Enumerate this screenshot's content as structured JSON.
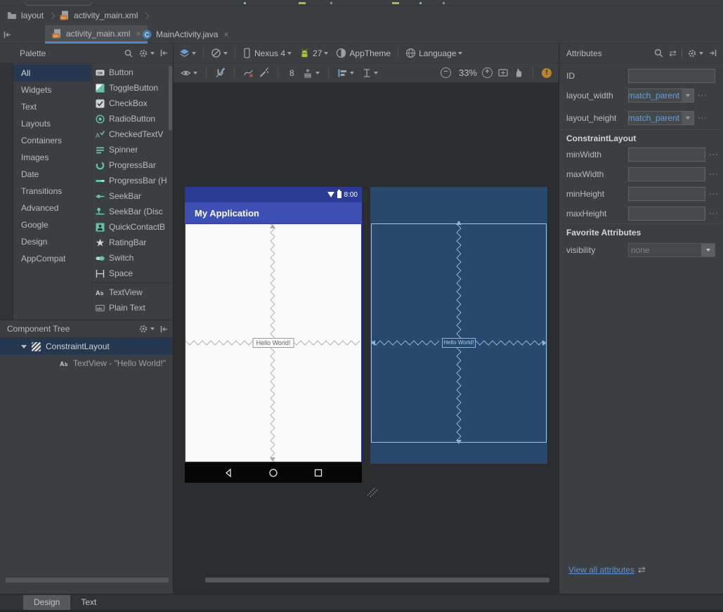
{
  "breadcrumb": {
    "items": [
      "layout",
      "activity_main.xml"
    ]
  },
  "editor_tabs": {
    "tabs": [
      {
        "label": "activity_main.xml",
        "close": "×"
      },
      {
        "label": "MainActivity.java",
        "close": "×"
      }
    ]
  },
  "palette": {
    "title": "Palette",
    "categories": [
      "All",
      "Widgets",
      "Text",
      "Layouts",
      "Containers",
      "Images",
      "Date",
      "Transitions",
      "Advanced",
      "Google",
      "Design",
      "AppCompat"
    ],
    "selected_category": "All",
    "items": [
      "Button",
      "ToggleButton",
      "CheckBox",
      "RadioButton",
      "CheckedTextV",
      "Spinner",
      "ProgressBar",
      "ProgressBar (H",
      "SeekBar",
      "SeekBar (Disc",
      "QuickContactB",
      "RatingBar",
      "Switch",
      "Space",
      "TextView",
      "Plain Text"
    ]
  },
  "component_tree": {
    "title": "Component Tree",
    "nodes": [
      {
        "label": "ConstraintLayout"
      },
      {
        "label": "TextView - \"Hello World!\""
      }
    ]
  },
  "design_toolbar": {
    "device": "Nexus 4",
    "api_level": "27",
    "theme": "AppTheme",
    "language": "Language",
    "default_margin": "8",
    "zoom_level": "33%",
    "zoom_out": "−",
    "zoom_in": "+",
    "error_badge": "!"
  },
  "preview": {
    "time": "8:00",
    "app_title": "My Application",
    "hello_text": "Hello World!"
  },
  "attributes": {
    "title": "Attributes",
    "id_label": "ID",
    "id_value": "",
    "layout_width_label": "layout_width",
    "layout_width_value": "match_parent",
    "layout_height_label": "layout_height",
    "layout_height_value": "match_parent",
    "constraint_section": "ConstraintLayout",
    "min_width_label": "minWidth",
    "max_width_label": "maxWidth",
    "min_height_label": "minHeight",
    "max_height_label": "maxHeight",
    "favorites_section": "Favorite Attributes",
    "visibility_label": "visibility",
    "visibility_value": "none",
    "more_button": "···",
    "view_all_link": "View all attributes",
    "swap_icon_glyph": "⇄"
  },
  "bottom_tabs": {
    "tabs": [
      "Design",
      "Text"
    ],
    "selected": "Design"
  },
  "colors": {
    "accent_teal": "#62c3ad",
    "selection_blue": "#263850",
    "tab_underline": "#4a88c7",
    "link_blue": "#5c93d6",
    "combo_value_blue": "#6d9ed6",
    "android_green": "#a0c23d",
    "preview_appbar": "#3e50b4",
    "preview_statusbar": "#2c3b96",
    "preview_selection_border": "#3037c8",
    "blueprint_bg": "#28496b",
    "blueprint_line": "#8ab6de",
    "xml_badge_orange": "#c8772f",
    "error_badge_orange": "#b9802f"
  }
}
